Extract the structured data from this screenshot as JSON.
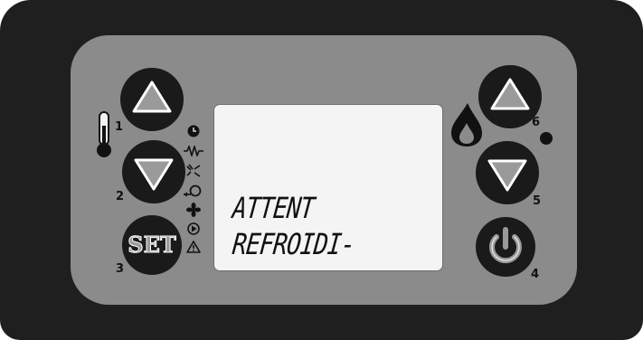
{
  "display": {
    "line1": "ATTENT",
    "line2": "REFROIDI-"
  },
  "buttons": {
    "b1": {
      "number": "1",
      "icon": "arrow-up-icon"
    },
    "b2": {
      "number": "2",
      "icon": "arrow-down-icon"
    },
    "b3": {
      "number": "3",
      "label": "SET"
    },
    "b4": {
      "number": "4",
      "icon": "power-icon"
    },
    "b5": {
      "number": "5",
      "icon": "arrow-down-icon"
    },
    "b6": {
      "number": "6",
      "icon": "arrow-up-icon"
    }
  },
  "status_icons": [
    "clock-icon",
    "resistor-icon",
    "spark-icon",
    "pump-icon",
    "fan-icon",
    "play-icon",
    "warning-icon"
  ],
  "colors": {
    "housing": "#1f1f1f",
    "faceplate": "#8b8b8b",
    "button": "#1a1a1a",
    "lcd": "#f4f4f4"
  }
}
